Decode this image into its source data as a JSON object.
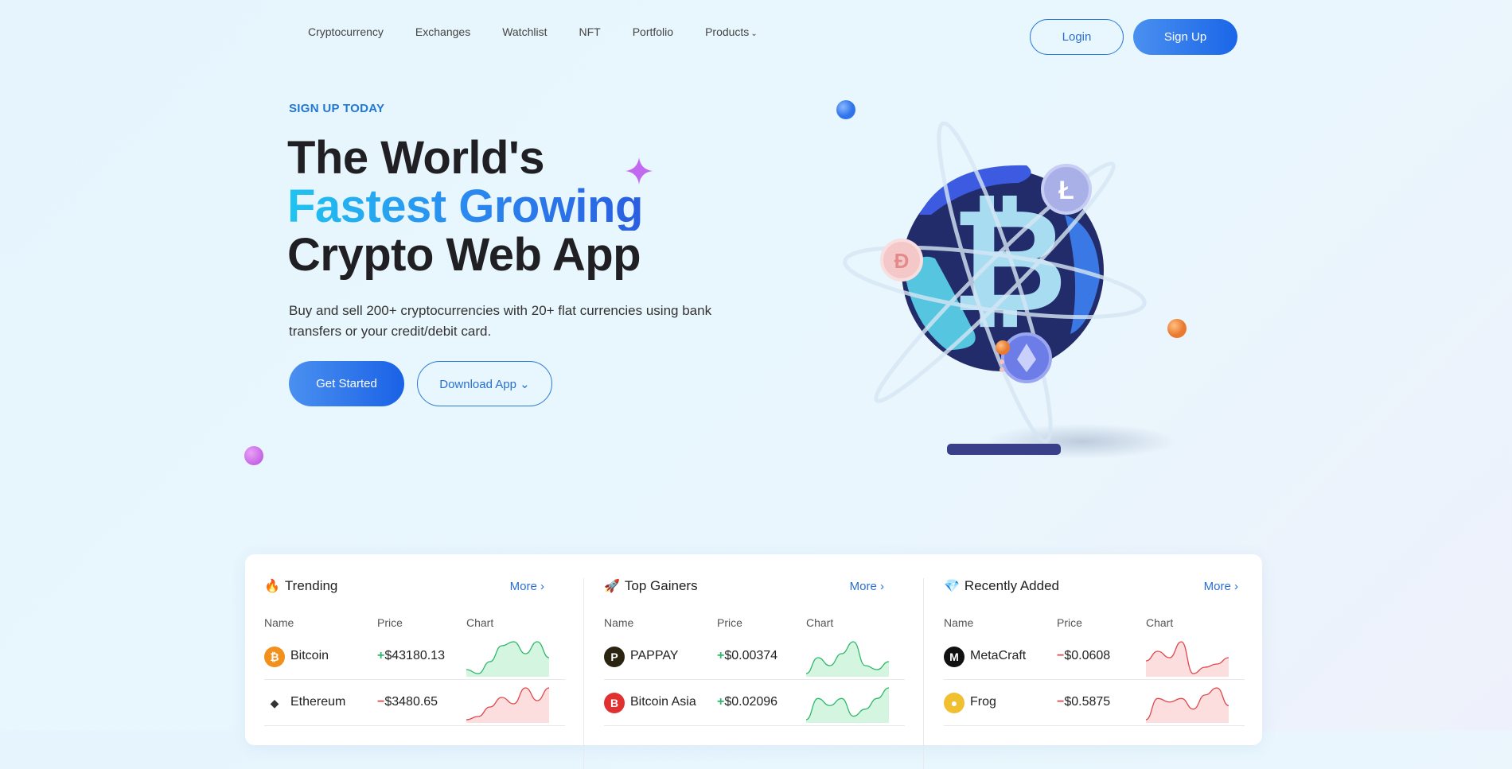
{
  "nav": {
    "items": [
      "Cryptocurrency",
      "Exchanges",
      "Watchlist",
      "NFT",
      "Portfolio",
      "Products"
    ],
    "login": "Login",
    "signup": "Sign Up"
  },
  "hero": {
    "eyebrow": "SIGN UP TODAY",
    "line1": "The World's",
    "line2": "Fastest Growing",
    "line3": "Crypto Web App",
    "description": "Buy and sell 200+ cryptocurrencies with 20+ flat currencies using bank transfers or your credit/debit card.",
    "get_started": "Get Started",
    "download": "Download App"
  },
  "colors": {
    "up": "#2fb86a",
    "down": "#e0474c",
    "accent": "#2a6fd0"
  },
  "panels": [
    {
      "title": "Trending",
      "icon": "fire-icon",
      "more": "More",
      "headers": [
        "Name",
        "Price",
        "Chart"
      ],
      "rows": [
        {
          "name": "Bitcoin",
          "sign": "+",
          "price": "$43180.13",
          "trend": "up",
          "spark": [
            3,
            2,
            5,
            9,
            10,
            7,
            10,
            6
          ]
        },
        {
          "name": "Ethereum",
          "sign": "−",
          "price": "$3480.65",
          "trend": "down",
          "spark": [
            1,
            2,
            5,
            8,
            6,
            11,
            7,
            11
          ]
        }
      ]
    },
    {
      "title": "Top Gainers",
      "icon": "rocket-icon",
      "more": "More",
      "headers": [
        "Name",
        "Price",
        "Chart"
      ],
      "rows": [
        {
          "name": "PAPPAY",
          "sign": "+",
          "price": "$0.00374",
          "trend": "up",
          "spark": [
            2,
            6,
            4,
            7,
            10,
            4,
            3,
            5
          ]
        },
        {
          "name": "Bitcoin Asia",
          "sign": "+",
          "price": "$0.02096",
          "trend": "up",
          "spark": [
            2,
            8,
            6,
            8,
            3,
            5,
            8,
            11
          ]
        }
      ]
    },
    {
      "title": "Recently Added",
      "icon": "diamond-icon",
      "more": "More",
      "headers": [
        "Name",
        "Price",
        "Chart"
      ],
      "rows": [
        {
          "name": "MetaCraft",
          "sign": "−",
          "price": "$0.0608",
          "trend": "down",
          "spark": [
            5,
            8,
            6,
            11,
            1,
            3,
            4,
            6
          ]
        },
        {
          "name": "Frog",
          "sign": "−",
          "price": "$0.5875",
          "trend": "down",
          "spark": [
            2,
            8,
            7,
            8,
            5,
            9,
            11,
            6
          ]
        }
      ]
    }
  ]
}
